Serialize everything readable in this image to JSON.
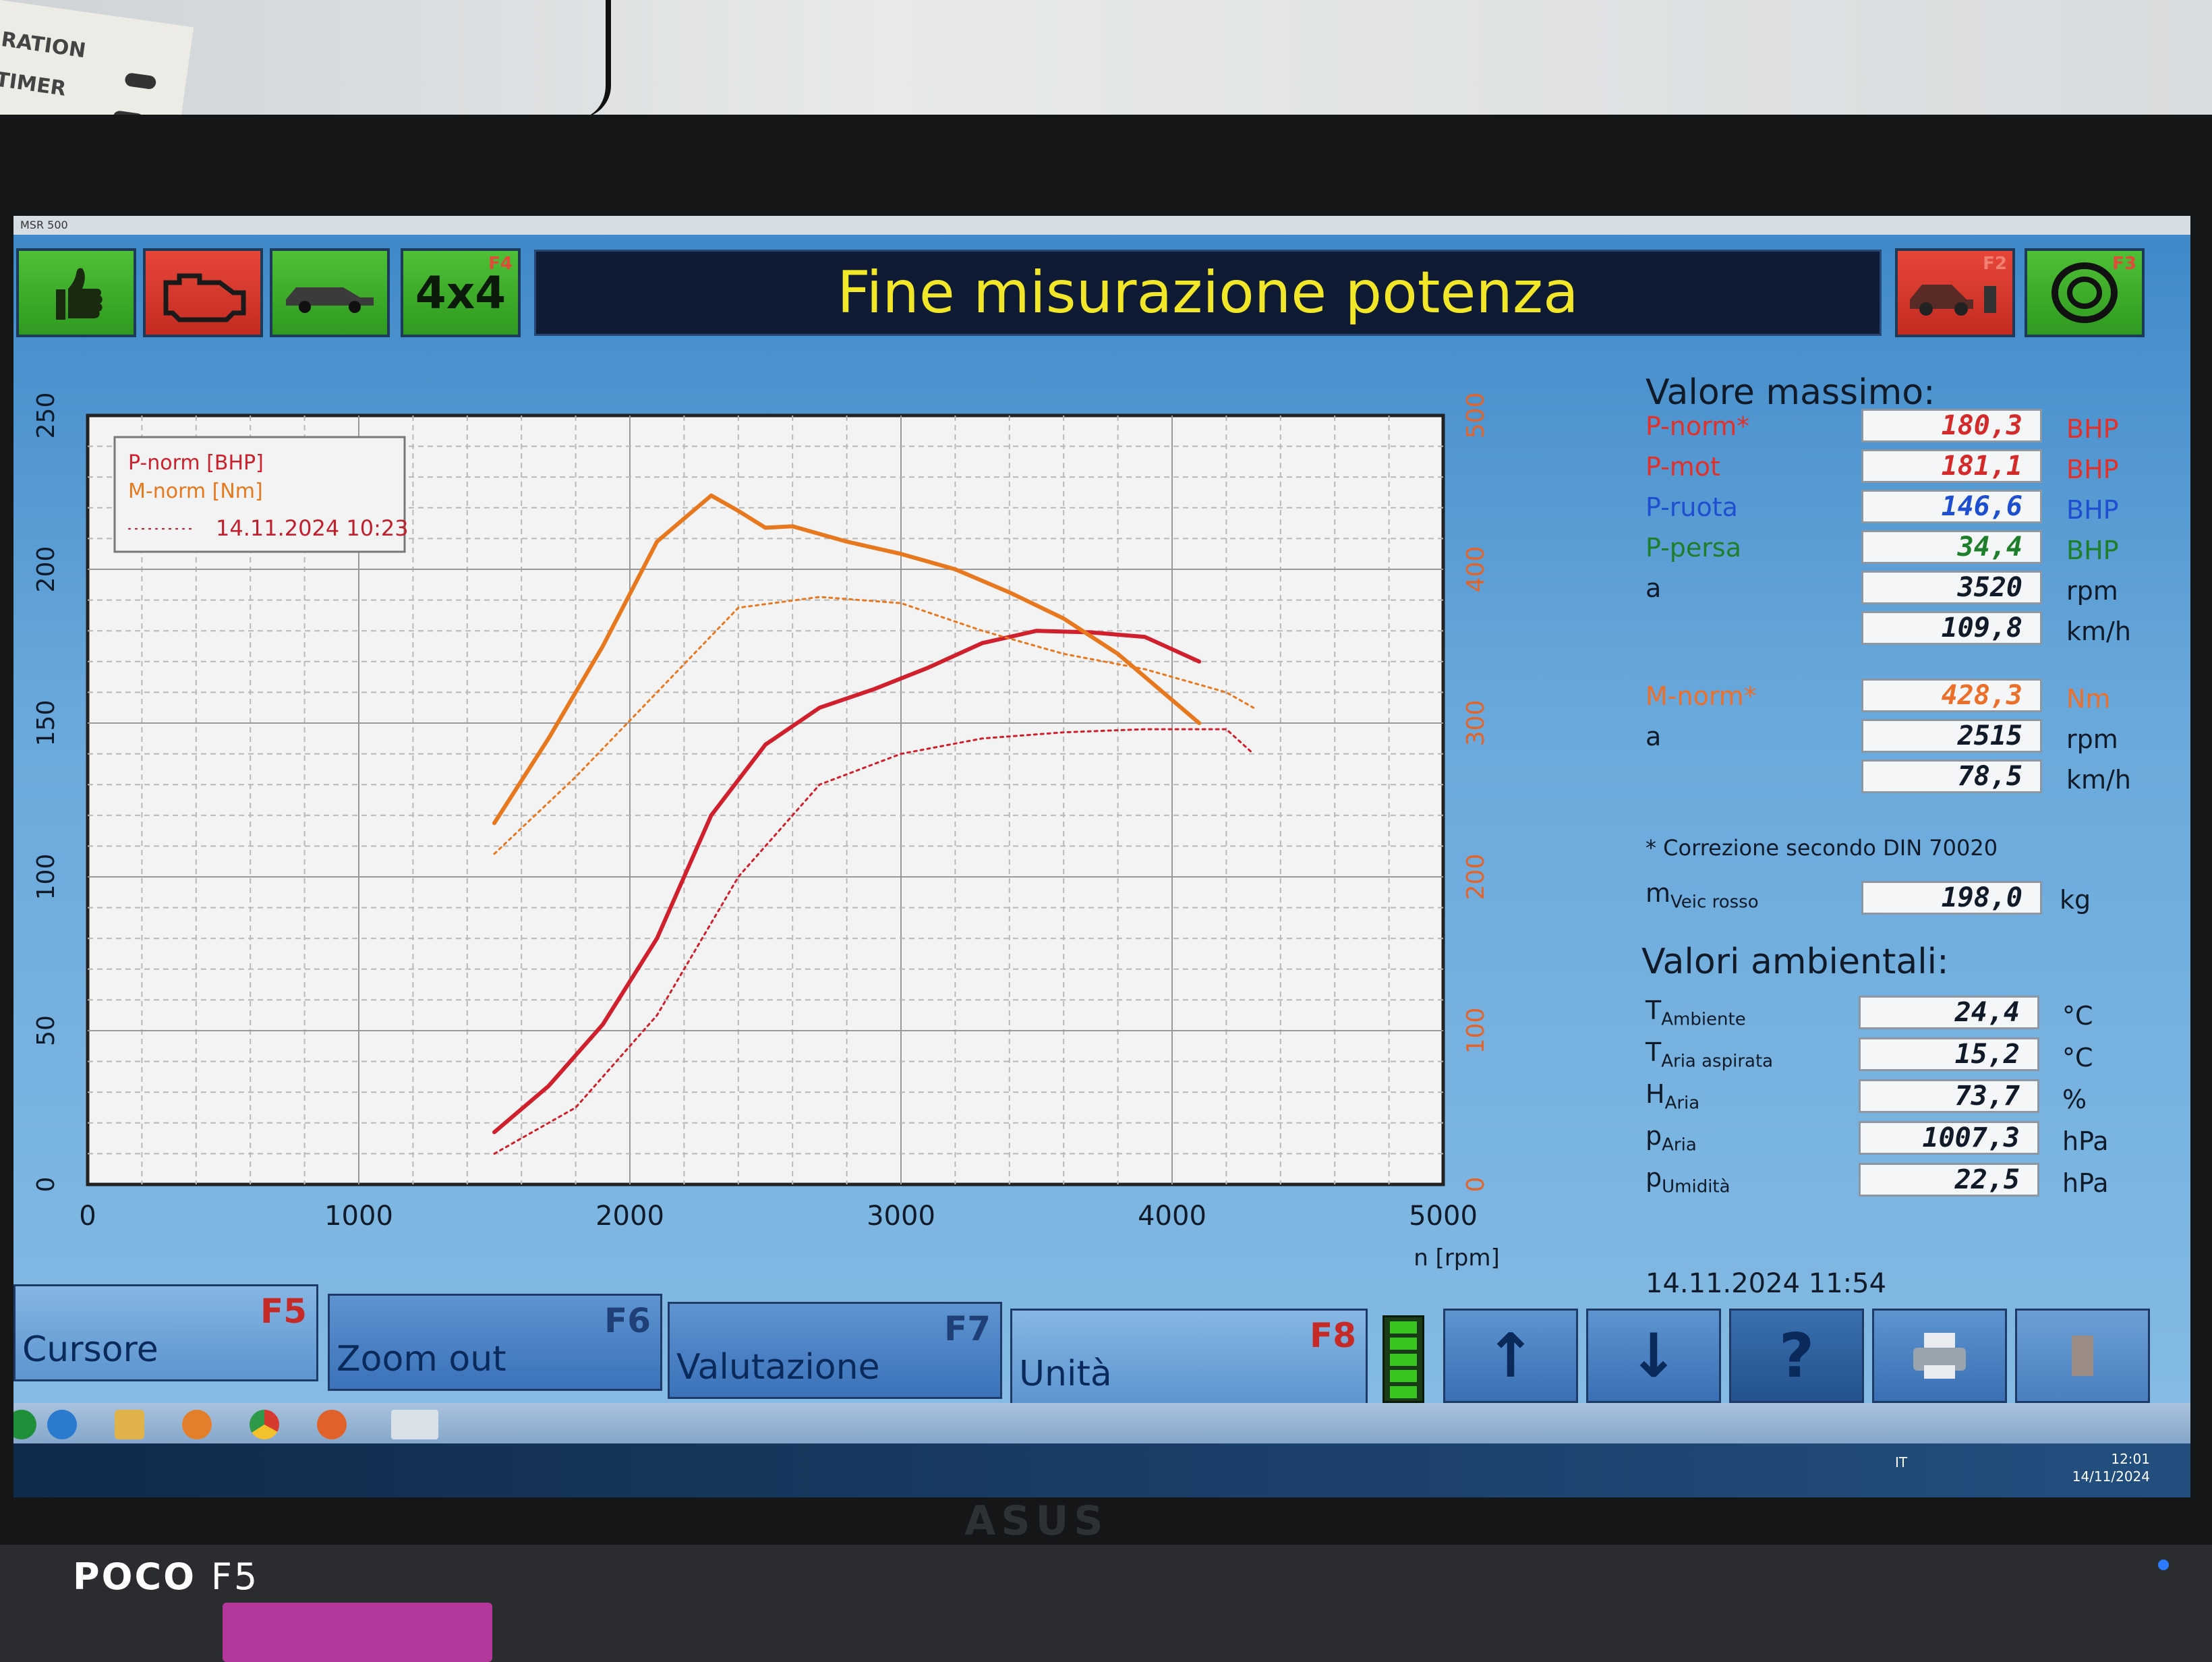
{
  "photo": {
    "paper_lines": [
      "RATION",
      "TIMER"
    ],
    "phone_brand": "POCO",
    "phone_model": "F5",
    "monitor_brand": "ASUS"
  },
  "window": {
    "app_title": "MSR 500"
  },
  "toolbar": {
    "btn_ok_icon": "thumbs-up-icon",
    "btn_engine_icon": "engine-icon",
    "btn_car_icon": "car-icon",
    "btn_4x4_label": "4x4",
    "btn_4x4_key": "F4",
    "title": "Fine misurazione potenza",
    "btn_car_red_key": "F2",
    "btn_wheel_key": "F3"
  },
  "chart_data": {
    "type": "line",
    "legend": {
      "entries": [
        "P-norm [BHP]",
        "M-norm [Nm]"
      ],
      "date": "14.11.2024 10:23",
      "placement": "top-left"
    },
    "xlabel": "n [rpm]",
    "xlim": [
      0,
      5000
    ],
    "x_ticks": [
      "0",
      "1000",
      "2000",
      "3000",
      "4000",
      "5000"
    ],
    "ylim_left": [
      0,
      250
    ],
    "y_ticks_left": [
      "0",
      "50",
      "100",
      "150",
      "200",
      "250"
    ],
    "ylim_right": [
      0,
      500
    ],
    "y_ticks_right": [
      "0",
      "100",
      "200",
      "300",
      "400",
      "500"
    ],
    "grid": true,
    "series": [
      {
        "name": "P-norm [BHP]",
        "axis": "left",
        "color": "#d0202e",
        "style": "solid",
        "x": [
          1500,
          1700,
          1900,
          2100,
          2300,
          2500,
          2700,
          2900,
          3100,
          3300,
          3500,
          3700,
          3900,
          4100
        ],
        "y": [
          17,
          32,
          52,
          80,
          120,
          143,
          155,
          161,
          168,
          176,
          180,
          179.5,
          178,
          170
        ]
      },
      {
        "name": "M-norm [Nm]",
        "axis": "right",
        "color": "#e8781e",
        "style": "solid",
        "x": [
          1500,
          1700,
          1900,
          2100,
          2300,
          2400,
          2500,
          2600,
          2800,
          3000,
          3200,
          3400,
          3600,
          3800,
          4000,
          4100
        ],
        "y": [
          235,
          290,
          350,
          418,
          448,
          438,
          427,
          428,
          418,
          410,
          400,
          385,
          368,
          345,
          315,
          300
        ]
      },
      {
        "name": "",
        "axis": "left",
        "color": "#d0202e",
        "style": "dotted",
        "x": [
          1500,
          1800,
          2100,
          2400,
          2700,
          3000,
          3300,
          3600,
          3900,
          4200,
          4300
        ],
        "y": [
          10,
          25,
          55,
          100,
          130,
          140,
          145,
          147,
          148,
          148,
          140
        ]
      },
      {
        "name": "",
        "axis": "right",
        "color": "#e8781e",
        "style": "dotted",
        "x": [
          1500,
          1800,
          2100,
          2400,
          2700,
          3000,
          3300,
          3600,
          3900,
          4200,
          4300
        ],
        "y": [
          215,
          265,
          320,
          375,
          382,
          378,
          360,
          345,
          335,
          320,
          310
        ]
      }
    ]
  },
  "results": {
    "max_title": "Valore massimo:",
    "rows": [
      {
        "label": "P-norm*",
        "value": "180,3",
        "unit": "BHP",
        "label_color": "#e2302a",
        "value_color": "#d52a2a"
      },
      {
        "label": "P-mot",
        "value": "181,1",
        "unit": "BHP",
        "label_color": "#e2302a",
        "value_color": "#d52a2a"
      },
      {
        "label": "P-ruota",
        "value": "146,6",
        "unit": "BHP",
        "label_color": "#1d4fd0",
        "value_color": "#1d4fd0"
      },
      {
        "label": "P-persa",
        "value": "34,4",
        "unit": "BHP",
        "label_color": "#1d7f2a",
        "value_color": "#1d7f2a"
      },
      {
        "label": "a",
        "value": "3520",
        "unit": "rpm",
        "label_color": "#101a28",
        "value_color": "#101a28"
      },
      {
        "label": "",
        "value": "109,8",
        "unit": "km/h",
        "label_color": "#101a28",
        "value_color": "#101a28"
      },
      {
        "label": "M-norm*",
        "value": "428,3",
        "unit": "Nm",
        "label_color": "#ec6f2a",
        "value_color": "#ec6f2a"
      },
      {
        "label": "a",
        "value": "2515",
        "unit": "rpm",
        "label_color": "#101a28",
        "value_color": "#101a28"
      },
      {
        "label": "",
        "value": "78,5",
        "unit": "km/h",
        "label_color": "#101a28",
        "value_color": "#101a28"
      }
    ],
    "din_note": "* Correzione secondo DIN 70020",
    "mass_label": "m",
    "mass_sub": "Veic rosso",
    "mass_value": "198,0",
    "mass_unit": "kg",
    "env_title": "Valori ambientali:",
    "env_rows": [
      {
        "label": "T",
        "sub": "Ambiente",
        "value": "24,4",
        "unit": "°C"
      },
      {
        "label": "T",
        "sub": "Aria aspirata",
        "value": "15,2",
        "unit": "°C"
      },
      {
        "label": "H",
        "sub": "Aria",
        "value": "73,7",
        "unit": "%"
      },
      {
        "label": "p",
        "sub": "Aria",
        "value": "1007,3",
        "unit": "hPa"
      },
      {
        "label": "p",
        "sub": "Umidità",
        "value": "22,5",
        "unit": "hPa"
      }
    ],
    "datetime": "14.11.2024  11:54"
  },
  "fkeys": [
    {
      "label": "Cursore",
      "key": "F5"
    },
    {
      "label": "Zoom out",
      "key": "F6"
    },
    {
      "label": "Valutazione",
      "key": "F7"
    },
    {
      "label": "Unità",
      "key": "F8"
    }
  ],
  "icon_buttons": {
    "up": "↑",
    "down": "↓",
    "help": "?"
  },
  "taskbar": {
    "clock_time": "12:01",
    "clock_date": "14/11/2024",
    "lang": "IT"
  }
}
